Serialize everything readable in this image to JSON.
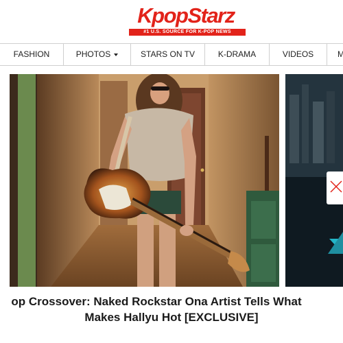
{
  "logo": {
    "wordmark": "KpopStarz",
    "tagline": "#1 U.S. SOURCE FOR K-POP NEWS",
    "color": "#e2231a"
  },
  "nav": {
    "items": [
      {
        "label": "FASHION"
      },
      {
        "label": "PHOTOS",
        "icon": "caret-down-icon"
      },
      {
        "label": "STARS ON TV"
      },
      {
        "label": "K-DRAMA"
      },
      {
        "label": "VIDEOS"
      },
      {
        "label": "M"
      }
    ]
  },
  "feature": {
    "headline_line1": "op Crossover: Naked Rockstar Ona Artist Tells What",
    "headline_line2": "Makes Hallyu Hot [EXCLUSIVE]"
  },
  "side_thumb": {
    "icon": "close-icon"
  }
}
